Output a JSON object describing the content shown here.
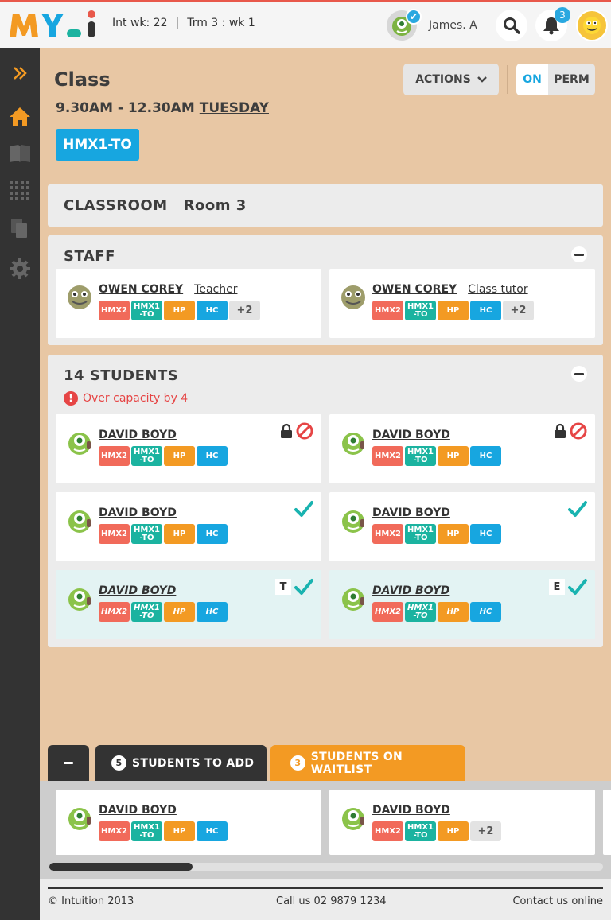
{
  "colors": {
    "accent": "#17a6e0",
    "brand_orange": "#f39a23",
    "tag_hmx2": "#f16a5a",
    "tag_hmx1": "#1bb3a0",
    "tag_hp": "#f39a23",
    "tag_hc": "#17a6e0",
    "tick": "#19b3b0",
    "danger": "#e64545"
  },
  "header": {
    "week": "Int wk: 22",
    "separator": "|",
    "term": "Trm 3 : wk 1",
    "user_name": "James. A",
    "notifications_count": "3"
  },
  "page": {
    "title": "Class",
    "time": "9.30AM - 12.30AM",
    "day": "TUESDAY",
    "class_code": "HMX1-TO",
    "actions_label": "ACTIONS",
    "toggle_on": "ON",
    "toggle_perm": "PERM"
  },
  "classroom": {
    "label": "CLASSROOM",
    "room": "Room 3"
  },
  "staff": {
    "title": "STAFF",
    "members": [
      {
        "name": "OWEN COREY",
        "role": "Teacher",
        "tags": [
          "HMX2",
          "HMX1\n-TO",
          "HP",
          "HC"
        ],
        "more": "+2"
      },
      {
        "name": "OWEN COREY",
        "role": "Class tutor",
        "tags": [
          "HMX2",
          "HMX1\n-TO",
          "HP",
          "HC"
        ],
        "more": "+2"
      }
    ]
  },
  "students": {
    "title": "14 STUDENTS",
    "warning": "Over capacity by 4",
    "list": [
      {
        "name": "DAVID BOYD",
        "tags": [
          "HMX2",
          "HMX1\n-TO",
          "HP",
          "HC"
        ],
        "status": "locked-blocked"
      },
      {
        "name": "DAVID BOYD",
        "tags": [
          "HMX2",
          "HMX1\n-TO",
          "HP",
          "HC"
        ],
        "status": "locked-blocked"
      },
      {
        "name": "DAVID BOYD",
        "tags": [
          "HMX2",
          "HMX1\n-TO",
          "HP",
          "HC"
        ],
        "status": "check"
      },
      {
        "name": "DAVID BOYD",
        "tags": [
          "HMX2",
          "HMX1\n-TO",
          "HP",
          "HC"
        ],
        "status": "check"
      },
      {
        "name": "DAVID BOYD",
        "tags": [
          "HMX2",
          "HMX1\n-TO",
          "HP",
          "HC"
        ],
        "status": "check",
        "badge": "T"
      },
      {
        "name": "DAVID BOYD",
        "tags": [
          "HMX2",
          "HMX1\n-TO",
          "HP",
          "HC"
        ],
        "status": "check",
        "badge": "E"
      }
    ]
  },
  "tray": {
    "tab_add_count": "5",
    "tab_add_label": "STUDENTS TO ADD",
    "tab_waitlist_count": "3",
    "tab_waitlist_label": "STUDENTS ON WAITLIST",
    "cards": [
      {
        "name": "DAVID BOYD",
        "tags": [
          "HMX2",
          "HMX1\n-TO",
          "HP",
          "HC"
        ]
      },
      {
        "name": "DAVID BOYD",
        "tags": [
          "HMX2",
          "HMX1\n-TO",
          "HP"
        ],
        "more": "+2"
      }
    ]
  },
  "footer": {
    "copyright": "© Intuition 2013",
    "phone": "Call us 02 9879 1234",
    "contact": "Contact us online"
  }
}
